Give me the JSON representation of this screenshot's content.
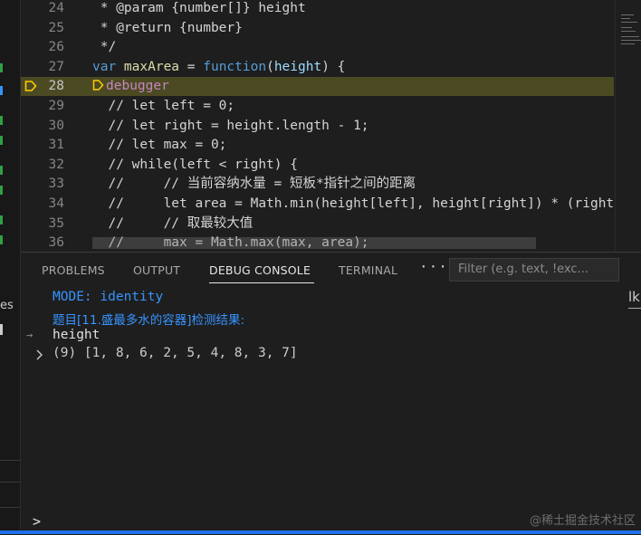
{
  "editor": {
    "lines": [
      {
        "n": "24",
        "segments": [
          {
            "t": " * @param {number[]} height",
            "c": "cmt"
          }
        ]
      },
      {
        "n": "25",
        "segments": [
          {
            "t": " * @return {number}",
            "c": "cmt"
          }
        ]
      },
      {
        "n": "26",
        "segments": [
          {
            "t": " */",
            "c": "cmt"
          }
        ]
      },
      {
        "n": "27",
        "segments": [
          {
            "t": "var ",
            "c": "kw"
          },
          {
            "t": "maxArea",
            "c": "fn"
          },
          {
            "t": " = ",
            "c": "cmt"
          },
          {
            "t": "function",
            "c": "kw"
          },
          {
            "t": "(",
            "c": "cmt"
          },
          {
            "t": "height",
            "c": "var"
          },
          {
            "t": ") {",
            "c": "cmt"
          }
        ]
      },
      {
        "n": "28",
        "segments": [
          {
            "t": "debugger",
            "c": "dbg"
          }
        ]
      },
      {
        "n": "29",
        "segments": [
          {
            "t": "  // let left = 0;",
            "c": "cmt"
          }
        ]
      },
      {
        "n": "30",
        "segments": [
          {
            "t": "  // let right = height.length - 1;",
            "c": "cmt"
          }
        ]
      },
      {
        "n": "31",
        "segments": [
          {
            "t": "  // let max = 0;",
            "c": "cmt"
          }
        ]
      },
      {
        "n": "32",
        "segments": [
          {
            "t": "  // while(left < right) {",
            "c": "cmt"
          }
        ]
      },
      {
        "n": "33",
        "segments": [
          {
            "t": "  //     // 当前容纳水量 = 短板*指针之间的距离",
            "c": "cmt"
          }
        ]
      },
      {
        "n": "34",
        "segments": [
          {
            "t": "  //     let area = Math.min(height[left], height[right]) * (right",
            "c": "cmt"
          }
        ]
      },
      {
        "n": "35",
        "segments": [
          {
            "t": "  //     // 取最较大值",
            "c": "cmt"
          }
        ]
      },
      {
        "n": "36",
        "segments": [
          {
            "t": "  //     max = Math.max(max, area);",
            "c": "cmt"
          }
        ]
      }
    ]
  },
  "panel": {
    "tabs": [
      "PROBLEMS",
      "OUTPUT",
      "DEBUG CONSOLE",
      "TERMINAL"
    ],
    "active_tab": "DEBUG CONSOLE",
    "more_label": "···",
    "filter_placeholder": "Filter (e.g. text, !exc...",
    "right_sliver_text": "lk",
    "console": {
      "mode_line": "MODE: identity",
      "result_line": "题目[11.盛最多水的容器]检测结果:",
      "input_echo": "height",
      "output": "(9) [1, 8, 6, 2, 5, 4, 8, 3, 7]"
    },
    "prompt": ">"
  },
  "left_strip": {
    "text_es": "es"
  },
  "watermark": "@稀土掘金技术社区",
  "colors": {
    "accent": "#3794ff",
    "current_line": "#4b4a22",
    "breakpoint": "#ffcc00"
  }
}
